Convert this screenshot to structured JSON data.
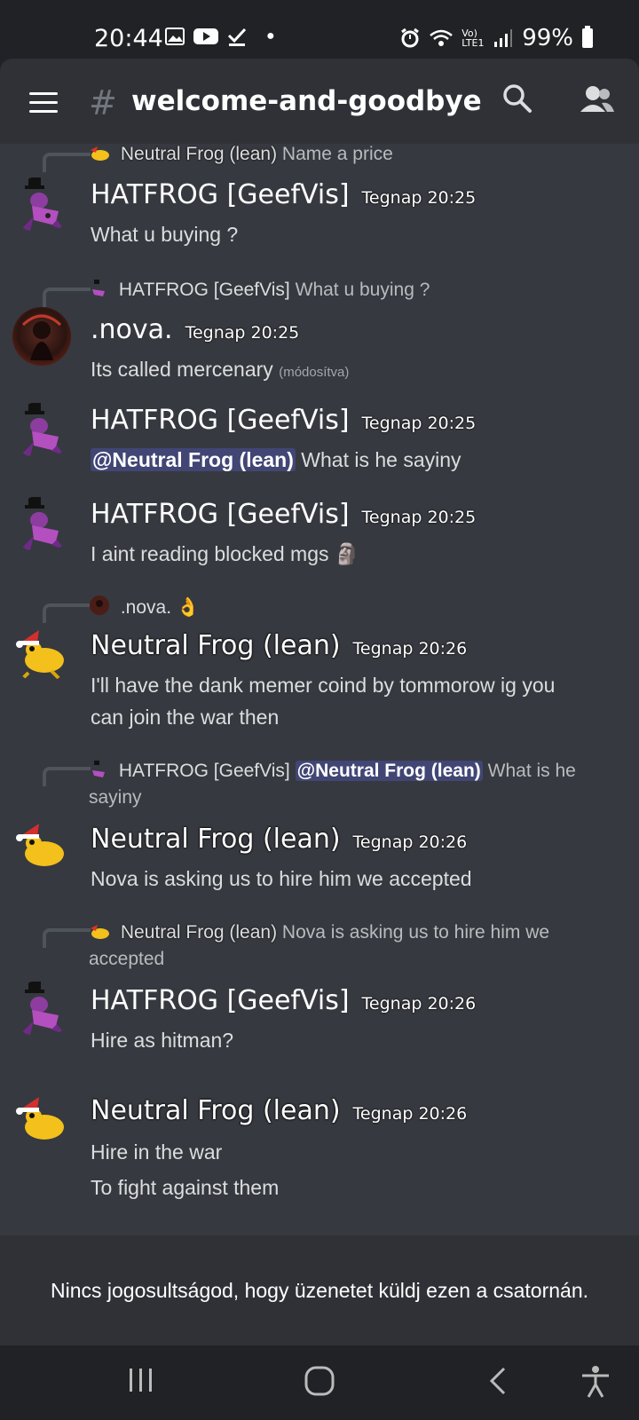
{
  "status_bar": {
    "time": "20:44",
    "network": "Vo) LTE1",
    "battery": "99%"
  },
  "header": {
    "hash": "#",
    "channel_name": "welcome-and-goodbye"
  },
  "messages": [
    {
      "reply_to": {
        "author": "Neutral Frog (lean)",
        "text": "Name a price"
      },
      "author": "HATFROG [GeefVis]",
      "timestamp": "Tegnap 20:25",
      "lines": [
        "What u buying ?"
      ]
    },
    {
      "reply_to": {
        "author": "HATFROG [GeefVis]",
        "text": "What u buying ?"
      },
      "author": ".nova.",
      "timestamp": "Tegnap 20:25",
      "lines": [
        "Its called mercenary"
      ],
      "edited": "(módosítva)"
    },
    {
      "author": "HATFROG [GeefVis]",
      "timestamp": "Tegnap 20:25",
      "mention": "@Neutral Frog (lean)",
      "lines": [
        "What is he sayiny"
      ]
    },
    {
      "author": "HATFROG [GeefVis]",
      "timestamp": "Tegnap 20:25",
      "lines": [
        "I aint reading blocked mgs 🗿"
      ]
    },
    {
      "reply_to": {
        "author": ".nova.",
        "text": "👌"
      },
      "author": "Neutral Frog (lean)",
      "timestamp": "Tegnap 20:26",
      "lines": [
        "I'll have the dank memer coind by tommorow ig you",
        "can join the war then"
      ]
    },
    {
      "reply_to": {
        "author": "HATFROG [GeefVis]",
        "mention": "@Neutral Frog (lean)",
        "text": "What is he",
        "text2": "sayiny"
      },
      "author": "Neutral Frog (lean)",
      "timestamp": "Tegnap 20:26",
      "lines": [
        "Nova is asking us to hire him we accepted"
      ]
    },
    {
      "reply_to": {
        "author": "Neutral Frog (lean)",
        "text": "Nova is asking us to hire him we",
        "text2": "accepted"
      },
      "author": "HATFROG [GeefVis]",
      "timestamp": "Tegnap 20:26",
      "lines": [
        "Hire as hitman?"
      ]
    },
    {
      "author": "Neutral Frog (lean)",
      "timestamp": "Tegnap 20:26",
      "lines": [
        "Hire in the war",
        "To fight against them"
      ]
    }
  ],
  "footer": {
    "no_permission": "Nincs jogosultságod, hogy üzenetet küldj ezen a csatornán."
  },
  "icons": [
    "menu-icon",
    "search-icon",
    "members-icon",
    "gallery-icon",
    "youtube-icon",
    "check-icon",
    "alarm-icon",
    "wifi-icon",
    "signal-icon",
    "battery-icon",
    "recents-icon",
    "home-icon",
    "back-icon",
    "accessibility-icon"
  ],
  "colors": {
    "chat_bg": "#36393f",
    "header_bg": "#2f3136",
    "status_bg": "#202225",
    "mention_bg": "#414675"
  }
}
